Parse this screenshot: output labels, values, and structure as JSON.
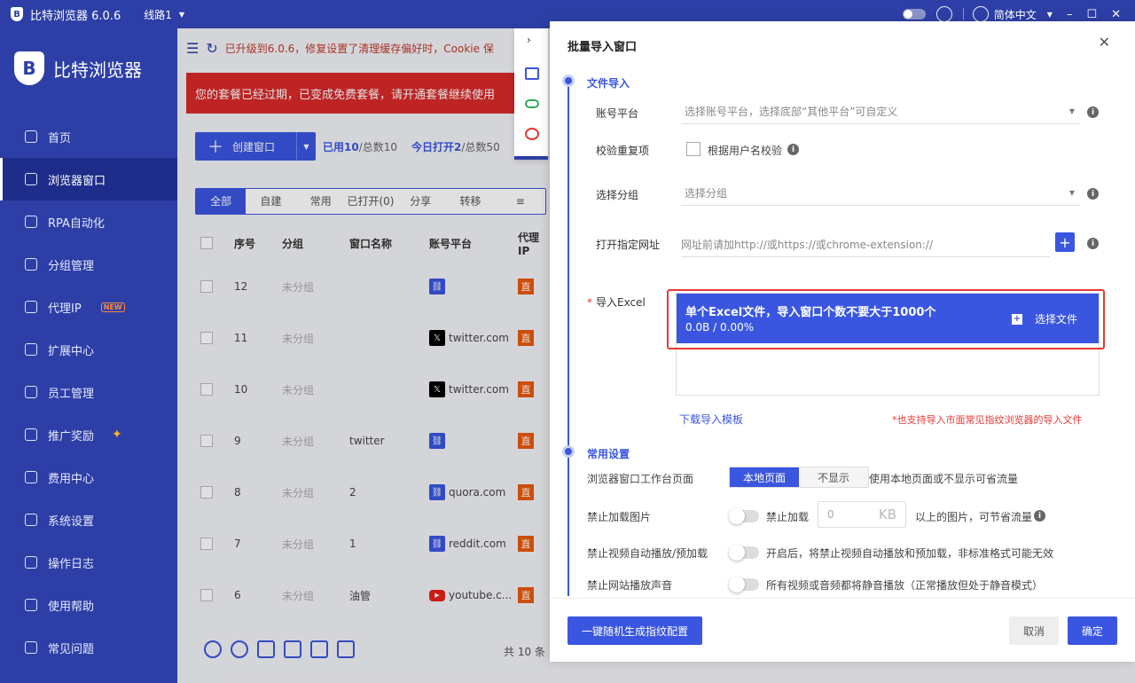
{
  "topbar": {
    "app_title": "比特浏览器 6.0.6",
    "line": "线路1",
    "language": "简体中文"
  },
  "sidebar": {
    "brand": "比特浏览器",
    "items": [
      {
        "label": "首页",
        "icon": "home-icon"
      },
      {
        "label": "浏览器窗口",
        "icon": "grid-icon"
      },
      {
        "label": "RPA自动化",
        "icon": "robot-icon"
      },
      {
        "label": "分组管理",
        "icon": "cube-icon"
      },
      {
        "label": "代理IP",
        "icon": "location-icon",
        "badge": "NEW"
      },
      {
        "label": "扩展中心",
        "icon": "box-icon"
      },
      {
        "label": "员工管理",
        "icon": "user-icon"
      },
      {
        "label": "推广奖励",
        "icon": "gift-icon"
      },
      {
        "label": "费用中心",
        "icon": "shield-yen-icon"
      },
      {
        "label": "系统设置",
        "icon": "gear-icon"
      },
      {
        "label": "操作日志",
        "icon": "log-icon"
      },
      {
        "label": "使用帮助",
        "icon": "help-icon"
      },
      {
        "label": "常见问题",
        "icon": "info-icon"
      }
    ]
  },
  "main": {
    "notice": "已升级到6.0.6，修复设置了清理缓存偏好时，Cookie 保",
    "alert": "您的套餐已经过期，已变成免费套餐，请开通套餐继续使用",
    "create_label": "创建窗口",
    "stat_used": "已用10",
    "stat_total": "/总数10",
    "stat_today": "今日打开2",
    "stat_today_total": "/总数50",
    "tabs": [
      "全部",
      "自建",
      "常用",
      "已打开(0)",
      "分享",
      "转移"
    ],
    "columns": [
      "序号",
      "分组",
      "窗口名称",
      "账号平台",
      "代理IP"
    ],
    "rows": [
      {
        "no": "12",
        "group": "未分组",
        "name": "",
        "platform": "",
        "ptype": "link"
      },
      {
        "no": "11",
        "group": "未分组",
        "name": "",
        "platform": "twitter.com",
        "ptype": "x"
      },
      {
        "no": "10",
        "group": "未分组",
        "name": "",
        "platform": "twitter.com",
        "ptype": "x"
      },
      {
        "no": "9",
        "group": "未分组",
        "name": "twitter",
        "platform": "",
        "ptype": "link"
      },
      {
        "no": "8",
        "group": "未分组",
        "name": "2",
        "platform": "quora.com",
        "ptype": "link"
      },
      {
        "no": "7",
        "group": "未分组",
        "name": "1",
        "platform": "reddit.com",
        "ptype": "link"
      },
      {
        "no": "6",
        "group": "未分组",
        "name": "油管",
        "platform": "youtube.c...",
        "ptype": "yt"
      }
    ],
    "proxy_badge": "直",
    "total": "共 10 条"
  },
  "modal": {
    "title": "批量导入窗口",
    "section1": "文件导入",
    "platform_label": "账号平台",
    "platform_placeholder": "选择账号平台，选择底部“其他平台”可自定义",
    "dedupe_label": "校验重复项",
    "dedupe_option": "根据用户名校验",
    "group_label": "选择分组",
    "group_placeholder": "选择分组",
    "url_label": "打开指定网址",
    "url_placeholder": "网址前请加http://或https://或chrome-extension://",
    "excel_label": "导入Excel",
    "excel_title": "单个Excel文件，导入窗口个数不要大于1000个",
    "excel_progress": "0.0B / 0.00%",
    "choose_file": "选择文件",
    "download_template": "下载导入模板",
    "support_tip": "*也支持导入市面常见指纹浏览器的导入文件",
    "section2": "常用设置",
    "workbench_label": "浏览器窗口工作台页面",
    "workbench_options": [
      "本地页面",
      "不显示"
    ],
    "workbench_hint": "使用本地页面或不显示可省流量",
    "img_label": "禁止加载图片",
    "img_switch_text": "禁止加载",
    "img_value": "0",
    "img_unit": "KB",
    "img_hint": "以上的图片，可节省流量",
    "video_label": "禁止视频自动播放/预加载",
    "video_hint": "开启后，将禁止视频自动播放和预加载，非标准格式可能无效",
    "sound_label": "禁止网站播放声音",
    "sound_hint": "所有视频或音频都将静音播放（正常播放但处于静音模式）",
    "random_btn": "一键随机生成指纹配置",
    "cancel": "取消",
    "ok": "确定"
  }
}
